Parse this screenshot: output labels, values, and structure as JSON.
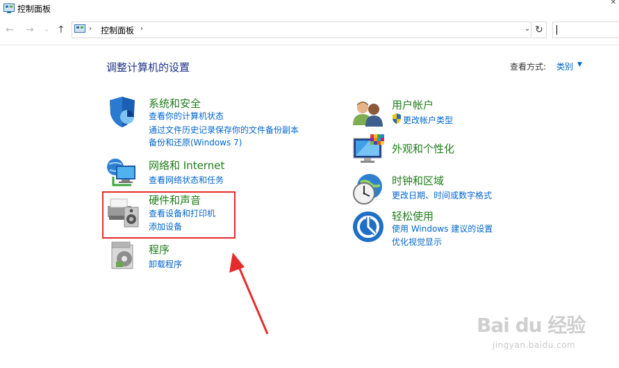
{
  "window": {
    "title": "控制面板",
    "close_icon": "close-x"
  },
  "address_bar": {
    "crumb": "控制面板",
    "separator": "›"
  },
  "page": {
    "heading": "调整计算机的设置"
  },
  "view_by": {
    "label": "查看方式:",
    "value": "类别"
  },
  "categories": [
    {
      "title": "系统和安全",
      "icon": "shield-icon",
      "links": [
        "查看你的计算机状态",
        "通过文件历史记录保存你的文件备份副本",
        "备份和还原(Windows 7)"
      ]
    },
    {
      "title": "网络和 Internet",
      "icon": "network-icon",
      "links": [
        "查看网络状态和任务"
      ]
    },
    {
      "title": "硬件和声音",
      "icon": "printer-speaker-icon",
      "links": [
        "查看设备和打印机",
        "添加设备"
      ]
    },
    {
      "title": "程序",
      "icon": "programs-disc-icon",
      "links": [
        "卸载程序"
      ]
    },
    {
      "title": "用户帐户",
      "icon": "users-icon",
      "links": [
        "更改帐户类型"
      ]
    },
    {
      "title": "外观和个性化",
      "icon": "display-palette-icon",
      "links": []
    },
    {
      "title": "时钟和区域",
      "icon": "clock-globe-icon",
      "links": [
        "更改日期、时间或数字格式"
      ]
    },
    {
      "title": "轻松使用",
      "icon": "ease-of-access-icon",
      "links": [
        "使用 Windows 建议的设置",
        "优化视觉显示"
      ]
    }
  ],
  "colors": {
    "category_title": "#1e7d18",
    "link": "#0066cc",
    "heading": "#1e3287",
    "highlight": "#e52b2b"
  },
  "watermark": {
    "logo": "Bai du 经验",
    "url": "jingyan.baidu.com"
  }
}
